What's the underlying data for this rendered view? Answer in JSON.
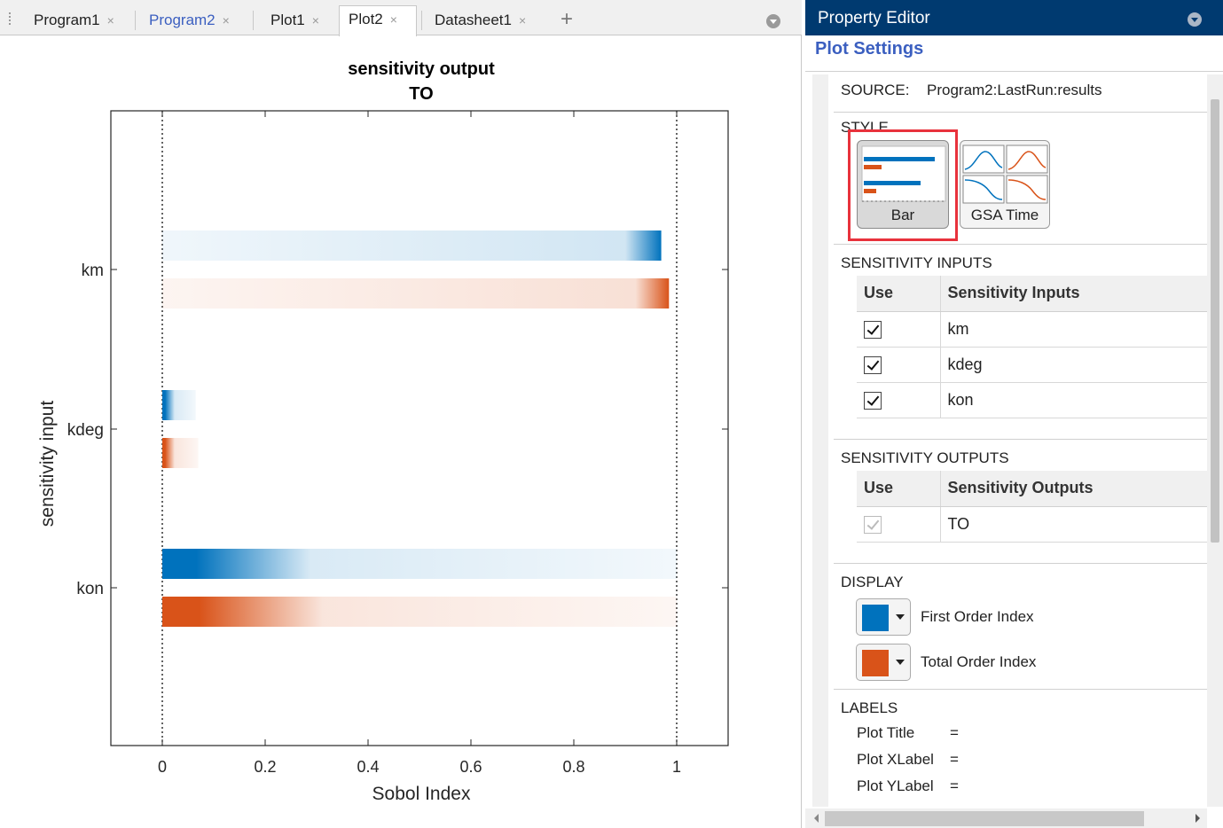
{
  "tabs": [
    {
      "label": "Program1",
      "style": "normal"
    },
    {
      "label": "Program2",
      "style": "blue"
    },
    {
      "label": "Plot1",
      "style": "normal"
    },
    {
      "label": "Plot2",
      "style": "active"
    },
    {
      "label": "Datasheet1",
      "style": "normal"
    }
  ],
  "tab_close_glyph": "×",
  "tab_add_glyph": "+",
  "chart_data": {
    "type": "bar",
    "orientation": "horizontal",
    "title": "sensitivity output",
    "subtitle": "TO",
    "xlabel": "Sobol Index",
    "ylabel": "sensitivity input",
    "categories": [
      "km",
      "kdeg",
      "kon"
    ],
    "xlim": [
      -0.1,
      1.1
    ],
    "xticks": [
      0,
      0.2,
      0.4,
      0.6,
      0.8,
      1
    ],
    "xtick_labels": [
      "0",
      "0.2",
      "0.4",
      "0.6",
      "0.8",
      "1"
    ],
    "reference_lines": [
      0,
      1
    ],
    "grid": false,
    "series": [
      {
        "name": "First Order Index",
        "color": "#0072bd",
        "values": [
          0.97,
          0.01,
          0.0
        ],
        "spread_to": [
          0.0,
          0.065,
          1.0
        ],
        "dense_to": [
          0.9,
          0.01,
          0.12
        ]
      },
      {
        "name": "Total Order Index",
        "color": "#d95319",
        "values": [
          0.985,
          0.01,
          0.0
        ],
        "spread_to": [
          0.0,
          0.07,
          1.0
        ],
        "dense_to": [
          0.92,
          0.01,
          0.13
        ]
      }
    ]
  },
  "property_editor": {
    "title": "Property Editor",
    "subtitle": "Plot Settings",
    "source_label": "SOURCE:",
    "source_value": "Program2:LastRun:results",
    "style_heading": "STYLE",
    "style_options": [
      {
        "label": "Bar",
        "selected": true
      },
      {
        "label": "GSA Time",
        "selected": false
      }
    ],
    "inputs_heading": "SENSITIVITY INPUTS",
    "inputs_columns": [
      "Use",
      "Sensitivity Inputs"
    ],
    "inputs_rows": [
      {
        "use": true,
        "name": "km"
      },
      {
        "use": true,
        "name": "kdeg"
      },
      {
        "use": true,
        "name": "kon"
      }
    ],
    "outputs_heading": "SENSITIVITY OUTPUTS",
    "outputs_columns": [
      "Use",
      "Sensitivity Outputs"
    ],
    "outputs_rows": [
      {
        "use": true,
        "disabled": true,
        "name": "TO"
      }
    ],
    "display_heading": "DISPLAY",
    "display_items": [
      {
        "label": "First Order Index",
        "color": "#0072bd"
      },
      {
        "label": "Total Order Index",
        "color": "#d95319"
      }
    ],
    "labels_heading": "LABELS",
    "labels_items": [
      {
        "label": "Plot Title",
        "value": "="
      },
      {
        "label": "Plot XLabel",
        "value": "="
      },
      {
        "label": "Plot YLabel",
        "value": "="
      }
    ]
  },
  "colors": {
    "header_bg": "#003a70",
    "accent_link": "#3b5fc0",
    "highlight_box": "#e8323c"
  }
}
